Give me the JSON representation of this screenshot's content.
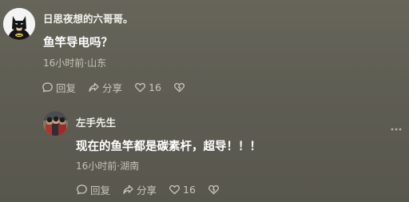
{
  "comment": {
    "author": "日思夜想的六哥哥。",
    "text": "鱼竿导电吗？",
    "meta": "16小时前·山东",
    "actions": {
      "reply_label": "回复",
      "share_label": "分享",
      "like_count": "16"
    }
  },
  "reply": {
    "author": "左手先生",
    "text": "现在的鱼竿都是碳素杆，超导！！！",
    "meta": "16小时前·湖南",
    "actions": {
      "reply_label": "回复",
      "share_label": "分享",
      "like_count": "16"
    }
  }
}
